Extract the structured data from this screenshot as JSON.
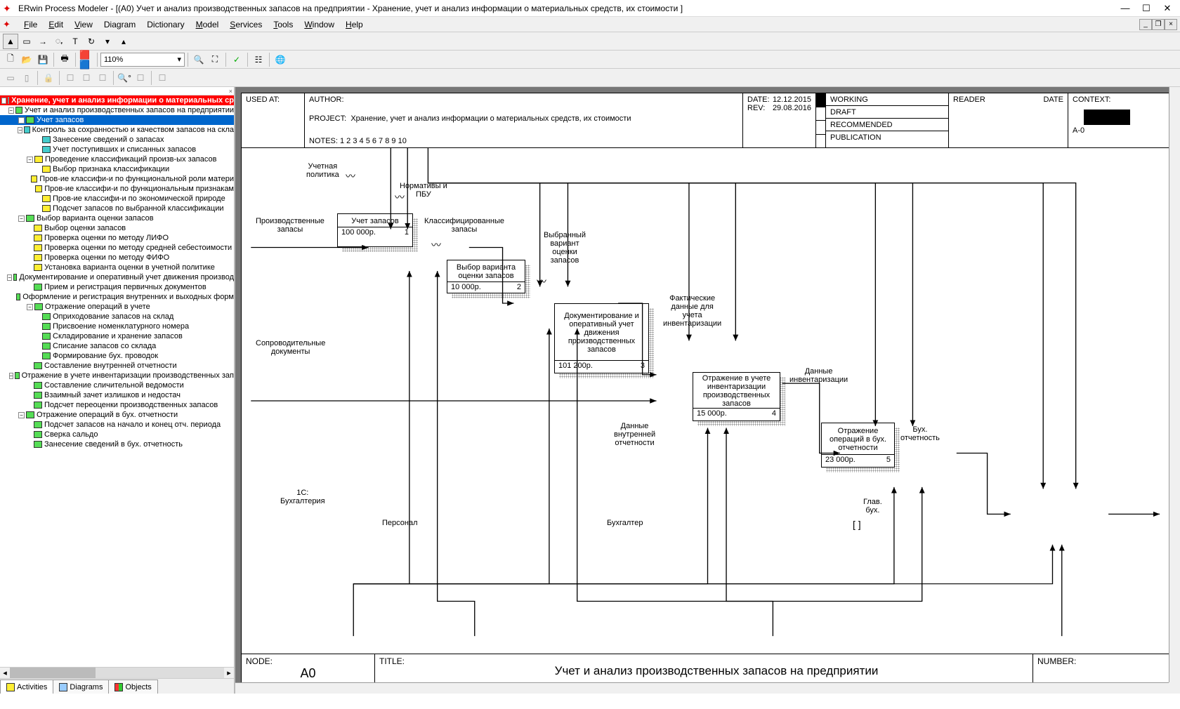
{
  "app": {
    "title": "ERwin Process Modeler - [(A0) Учет и анализ производственных запасов на предприятии - Хранение, учет и анализ информации о материальных средств, их стоимости ]"
  },
  "menu": {
    "items": [
      "File",
      "Edit",
      "View",
      "Diagram",
      "Dictionary",
      "Model",
      "Services",
      "Tools",
      "Window",
      "Help"
    ]
  },
  "zoom": "110%",
  "tree": {
    "root": "Хранение, учет и анализ информации о материальных ср",
    "n1": "Учет и анализ производственных запасов на предприятии",
    "n1_1": "Учет запасов",
    "n1_1_1": "Контроль за  сохранностью и качеством запасов на скла",
    "n1_1_1_1": "Занесение сведений  о запасах",
    "n1_1_1_2": "Учет поступивших и списанных запасов",
    "n1_1_2": "Проведение  классификаций произв-ых  запасов",
    "n1_1_2_1": "Выбор признака классификации",
    "n1_1_2_2": "Пров-ие классифи-и по  функциональной роли матери",
    "n1_1_2_3": "Пров-ие классифи-и по функциональным  признакам",
    "n1_1_2_4": "Пров-ие классифи-и по  экономической природе",
    "n1_1_2_5": "Подсчет запасов по выбранной классификации",
    "n1_2": "Выбор варианта  оценки запасов",
    "n1_2_1": "Выбор оценки  запасов",
    "n1_2_2": "Проверка оценки  по методу ЛИФО",
    "n1_2_3": "Проверка оценки  по методу средней себестоимости",
    "n1_2_4": "Проверка оценки  по методу ФИФО",
    "n1_2_5": "Установка варианта оценки в учетной политике",
    "n1_3": "Документирование  и оперативный учет  движения производ",
    "n1_3_1": "Прием и регистрация первичных документов",
    "n1_3_2": "Оформление и регистрация  внутренних и выходных форм",
    "n1_3_3": "Отражение операций в учете",
    "n1_3_3_1": "Оприходование  запасов на склад",
    "n1_3_3_2": "Присвоение номенклатурного номера",
    "n1_3_3_3": "Складирование  и хранение запасов",
    "n1_3_3_4": "Списание запасов  со склада",
    "n1_3_3_5": "Формирование бух. проводок",
    "n1_3_4": "Составление  внутренней  отчетности",
    "n1_4": "Отражение в учете  инвентаризации  производственных  зап",
    "n1_4_1": "Составление  сличительной  ведомости",
    "n1_4_2": "Взаимный зачет  излишков и  недостач",
    "n1_4_3": "Подсчет  переоценки  производственных  запасов",
    "n1_5": "Отражение  операций в  бух. отчетности",
    "n1_5_1": "Подсчет запасов  на начало и конец  отч. периода",
    "n1_5_2": "Сверка сальдо",
    "n1_5_3": "Занесение сведений  в бух. отчетность"
  },
  "tree_tabs": {
    "activities": "Activities",
    "diagrams": "Diagrams",
    "objects": "Objects"
  },
  "header": {
    "used_at": "USED AT:",
    "author": "AUTHOR:",
    "project": "PROJECT:",
    "project_val": "Хранение, учет и анализ информации о материальных средств, их стоимости",
    "date_lbl": "DATE:",
    "date_val": "12.12.2015",
    "rev_lbl": "REV:",
    "rev_val": "29.08.2016",
    "notes": "NOTES:  1  2  3  4  5  6  7  8  9  10",
    "working": "WORKING",
    "draft": "DRAFT",
    "recommended": "RECOMMENDED",
    "publication": "PUBLICATION",
    "reader": "READER",
    "date": "DATE",
    "context": "CONTEXT:",
    "context_id": "A-0"
  },
  "boxes": {
    "b1": {
      "title": "Учет запасов",
      "cost": "100 000р.",
      "num": "1"
    },
    "b2": {
      "title": "Выбор варианта оценки запасов",
      "cost": "10 000р.",
      "num": "2"
    },
    "b3": {
      "title": "Документирование и оперативный учет движения производственных запасов",
      "cost": "101 200р.",
      "num": "3"
    },
    "b4": {
      "title": "Отражение в учете инвентаризации производственных запасов",
      "cost": "15 000р.",
      "num": "4"
    },
    "b5": {
      "title": "Отражение операций в бух. отчетности",
      "cost": "23 000р.",
      "num": "5"
    }
  },
  "labels": {
    "uchet_pol": "Учетная\nполитика",
    "normativy": "Нормативы и\nПБУ",
    "proizv_zapasy": "Производственные\nзапасы",
    "klass_zapasy": "Классифицированные\nзапасы",
    "vybr_variant": "Выбранный\nвариант\nоценки\nзапасов",
    "soprov_doc": "Сопроводительные\nдокументы",
    "fakt_dannye": "Фактические\nданные для\nучета\nинвентаризации",
    "dannye_vnutr": "Данные\nвнутренней\nотчетности",
    "dannye_inv": "Данные\nинвентаризации",
    "bukh_otch": "Бух.\nотчетность",
    "1c": "1С:\nБухгалтерия",
    "personal": "Персонал",
    "bukhgalter": "Бухгалтер",
    "glav_bukh": "Глав.\nбух."
  },
  "footer": {
    "node_lbl": "NODE:",
    "node_val": "A0",
    "title_lbl": "TITLE:",
    "title_val": "Учет и анализ производственных запасов на предприятии",
    "number_lbl": "NUMBER:"
  }
}
